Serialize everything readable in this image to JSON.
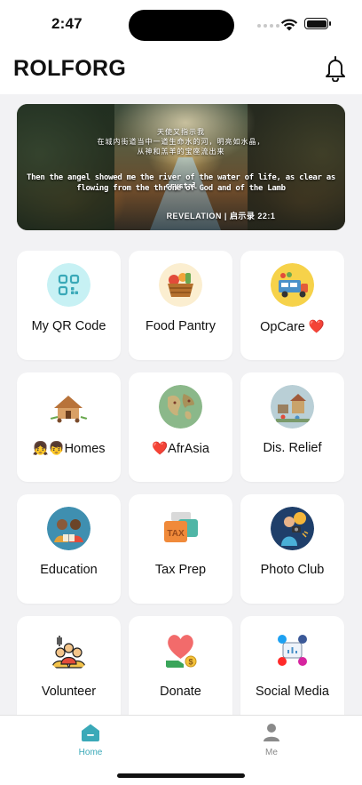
{
  "status_bar": {
    "time": "2:47"
  },
  "header": {
    "title": "ROLFORG"
  },
  "banner": {
    "chinese_line1": "天使又指示我",
    "chinese_line2": "在城内街道当中一道生命水的河，明亮如水晶，",
    "chinese_line3": "从神和羔羊的宝座流出来",
    "english_line1": "Then the angel showed me the river of the water of life, as clear as crystal",
    "english_line2": "flowing from the throne of God and of the Lamb",
    "reference": "REVELATION | 启示录 22:1"
  },
  "tiles": [
    {
      "label": "My QR Code",
      "icon": "qr-code-icon"
    },
    {
      "label": "Food Pantry",
      "icon": "food-basket-icon"
    },
    {
      "label": "OpCare ❤️",
      "icon": "food-truck-icon"
    },
    {
      "label": "👧👦Homes",
      "icon": "village-huts-icon"
    },
    {
      "label": "❤️AfrAsia",
      "icon": "map-globe-icon"
    },
    {
      "label": "Dis. Relief",
      "icon": "disaster-relief-icon"
    },
    {
      "label": "Education",
      "icon": "children-education-icon"
    },
    {
      "label": "Tax Prep",
      "icon": "tax-documents-icon"
    },
    {
      "label": "Photo Club",
      "icon": "photographer-icon"
    },
    {
      "label": "Volunteer",
      "icon": "volunteer-group-icon"
    },
    {
      "label": "Donate",
      "icon": "donate-heart-icon"
    },
    {
      "label": "Social Media",
      "icon": "social-media-icon"
    }
  ],
  "tabbar": {
    "home_label": "Home",
    "me_label": "Me",
    "active_color": "#3aa9b8",
    "inactive_color": "#8a8a8a"
  }
}
